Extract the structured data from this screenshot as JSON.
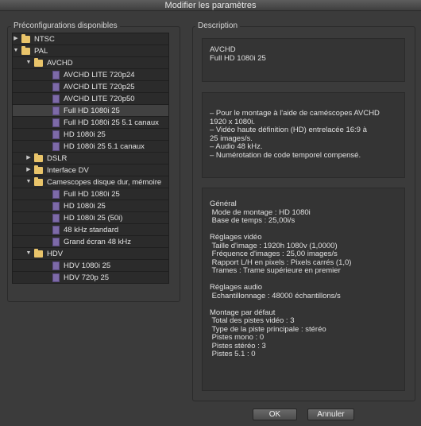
{
  "window": {
    "title": "Modifier les paramètres"
  },
  "presets": {
    "group_label": "Préconfigurations disponibles",
    "tree": [
      {
        "label": "NTSC",
        "kind": "folder",
        "level": 0,
        "expanded": false,
        "selected": false
      },
      {
        "label": "PAL",
        "kind": "folder",
        "level": 0,
        "expanded": true,
        "selected": false
      },
      {
        "label": "AVCHD",
        "kind": "folder",
        "level": 1,
        "expanded": true,
        "selected": false
      },
      {
        "label": "AVCHD LITE 720p24",
        "kind": "preset",
        "level": 2,
        "selected": false
      },
      {
        "label": "AVCHD LITE 720p25",
        "kind": "preset",
        "level": 2,
        "selected": false
      },
      {
        "label": "AVCHD LITE 720p50",
        "kind": "preset",
        "level": 2,
        "selected": false
      },
      {
        "label": "Full HD 1080i 25",
        "kind": "preset",
        "level": 2,
        "selected": true
      },
      {
        "label": "Full HD 1080i 25 5.1 canaux",
        "kind": "preset",
        "level": 2,
        "selected": false
      },
      {
        "label": "HD 1080i 25",
        "kind": "preset",
        "level": 2,
        "selected": false
      },
      {
        "label": "HD 1080i 25 5.1 canaux",
        "kind": "preset",
        "level": 2,
        "selected": false
      },
      {
        "label": "DSLR",
        "kind": "folder",
        "level": 1,
        "expanded": false,
        "selected": false
      },
      {
        "label": "Interface DV",
        "kind": "folder",
        "level": 1,
        "expanded": false,
        "selected": false
      },
      {
        "label": "Camescopes disque dur, mémoire",
        "kind": "folder",
        "level": 1,
        "expanded": true,
        "selected": false
      },
      {
        "label": "Full HD 1080i 25",
        "kind": "preset",
        "level": 2,
        "selected": false
      },
      {
        "label": "HD 1080i 25",
        "kind": "preset",
        "level": 2,
        "selected": false
      },
      {
        "label": "HD 1080i 25 (50i)",
        "kind": "preset",
        "level": 2,
        "selected": false
      },
      {
        "label": "48 kHz standard",
        "kind": "preset",
        "level": 2,
        "selected": false
      },
      {
        "label": "Grand écran 48 kHz",
        "kind": "preset",
        "level": 2,
        "selected": false
      },
      {
        "label": "HDV",
        "kind": "folder",
        "level": 1,
        "expanded": true,
        "selected": false
      },
      {
        "label": "HDV 1080i 25",
        "kind": "preset",
        "level": 2,
        "selected": false
      },
      {
        "label": "HDV 720p 25",
        "kind": "preset",
        "level": 2,
        "selected": false
      }
    ]
  },
  "description": {
    "group_label": "Description",
    "name_lines": [
      "AVCHD",
      "Full HD 1080i 25"
    ],
    "text_lines": [
      "– Pour le montage à l'aide de caméscopes AVCHD",
      "1920 x 1080i.",
      "– Vidéo haute définition (HD) entrelacée 16:9 à",
      "25 images/s.",
      "– Audio 48 kHz.",
      "– Numérotation de code temporel compensé."
    ],
    "details_lines": [
      "Général",
      " Mode de montage : HD 1080i",
      " Base de temps : 25,00i/s",
      "",
      "Réglages vidéo",
      " Taille d'image : 1920h 1080v (1,0000)",
      " Fréquence d'images : 25,00 images/s",
      " Rapport L/H en pixels : Pixels carrés (1,0)",
      " Trames : Trame supérieure en premier",
      "",
      "Réglages audio",
      " Echantillonnage : 48000 échantillons/s",
      "",
      "Montage par défaut",
      " Total des pistes vidéo : 3",
      " Type de la piste principale : stéréo",
      " Pistes mono : 0",
      " Pistes stéréo : 3",
      " Pistes 5.1 : 0"
    ]
  },
  "footer": {
    "ok_label": "OK",
    "cancel_label": "Annuler"
  },
  "colors": {
    "background": "#3b3b3b",
    "folder": "#e9c46a",
    "preset_icon": "#7d6aa8"
  }
}
